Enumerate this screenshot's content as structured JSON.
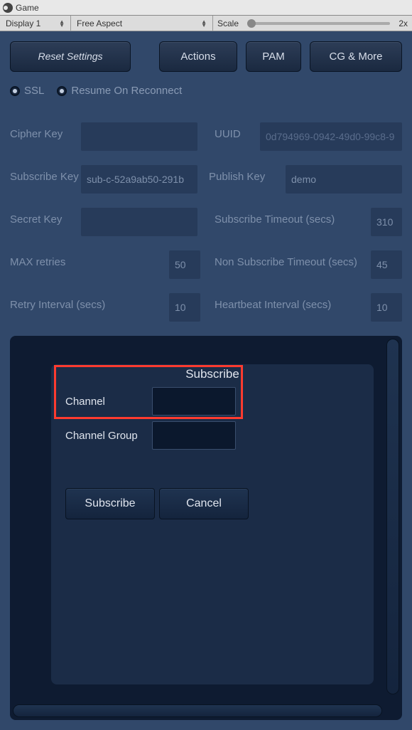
{
  "window": {
    "title": "Game"
  },
  "toolbar": {
    "display": "Display 1",
    "aspect": "Free Aspect",
    "scale_label": "Scale",
    "scale_value": "2x"
  },
  "topbuttons": {
    "reset": "Reset Settings",
    "actions": "Actions",
    "pam": "PAM",
    "cgmore": "CG & More"
  },
  "checks": {
    "ssl": "SSL",
    "resume": "Resume On Reconnect"
  },
  "form": {
    "cipher_key_label": "Cipher Key",
    "cipher_key_value": "",
    "uuid_label": "UUID",
    "uuid_value": "0d794969-0942-49d0-99c8-9",
    "subscribe_key_label": "Subscribe Key",
    "subscribe_key_value": "sub-c-52a9ab50-291b",
    "publish_key_label": "Publish Key",
    "publish_key_value": "demo",
    "secret_key_label": "Secret Key",
    "secret_key_value": "",
    "sub_timeout_label": "Subscribe Timeout (secs)",
    "sub_timeout_value": "310",
    "max_retries_label": "MAX retries",
    "max_retries_value": "50",
    "nonsub_timeout_label": "Non Subscribe Timeout (secs)",
    "nonsub_timeout_value": "45",
    "retry_interval_label": "Retry Interval (secs)",
    "retry_interval_value": "10",
    "heartbeat_label": "Heartbeat Interval (secs)",
    "heartbeat_value": "10"
  },
  "dialog": {
    "title": "Subscribe",
    "channel_label": "Channel",
    "channel_value": "",
    "channel_group_label": "Channel Group",
    "channel_group_value": "",
    "subscribe_btn": "Subscribe",
    "cancel_btn": "Cancel"
  }
}
